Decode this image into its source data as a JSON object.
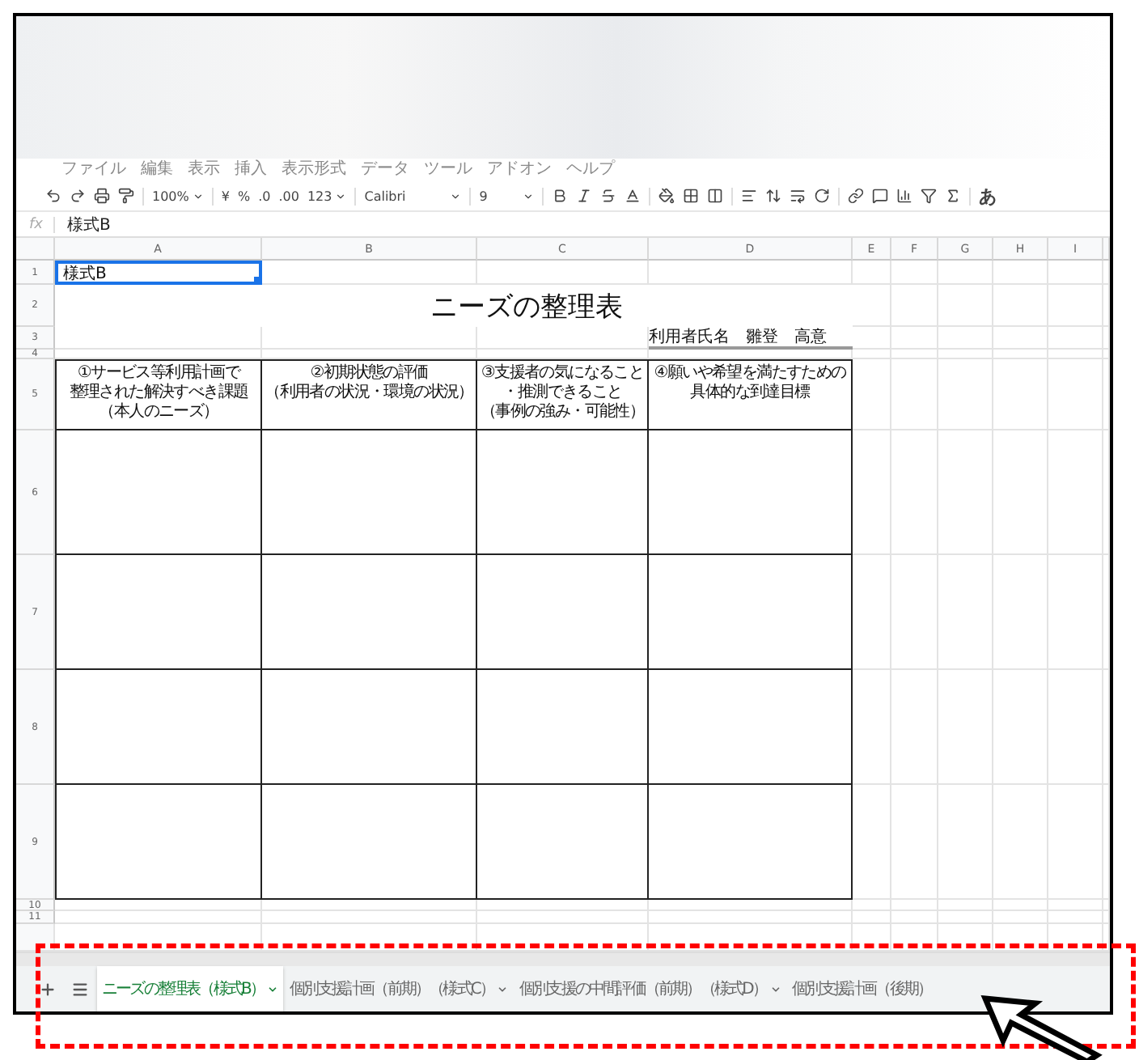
{
  "menu": [
    "ファイル",
    "編集",
    "表示",
    "挿入",
    "表示形式",
    "データ",
    "ツール",
    "アドオン",
    "ヘルプ"
  ],
  "toolbar": {
    "zoom": "100%",
    "currency": "¥",
    "percent": "%",
    "decimal_less": ".0",
    "decimal_more": ".00",
    "number_format": "123",
    "font": "Calibri",
    "font_size": "9",
    "input_mode": "あ"
  },
  "formula_bar": {
    "label": "fx",
    "value": "様式B"
  },
  "columns": [
    "A",
    "B",
    "C",
    "D",
    "E",
    "F",
    "G",
    "H",
    "I"
  ],
  "rows": [
    {
      "number": "1",
      "cells": [
        {
          "kind": "plain",
          "text": "様式B",
          "selected": true
        }
      ]
    },
    {
      "number": "2",
      "cells": [
        {
          "kind": "title",
          "text": "ニーズの整理表"
        }
      ]
    },
    {
      "number": "3",
      "cells": [
        {
          "kind": "owner",
          "text": "利用者氏名　雛登　高意"
        }
      ]
    },
    {
      "number": "4"
    },
    {
      "number": "5",
      "cells": [
        {
          "kind": "header",
          "lines": [
            "①サービス等利用計画で",
            "整理された解決すべき課題",
            "（本人のニーズ）"
          ]
        },
        {
          "kind": "header",
          "lines": [
            "②初期状態の評価",
            "（利用者の状況・環境の状況）"
          ]
        },
        {
          "kind": "header",
          "lines": [
            "③支援者の気になること",
            "・推測できること",
            "（事例の強み・可能性）"
          ]
        },
        {
          "kind": "header",
          "lines": [
            "④願いや希望を満たすための",
            "具体的な到達目標"
          ]
        }
      ]
    },
    {
      "number": "6",
      "cells": [
        {
          "kind": "box"
        },
        {
          "kind": "box"
        },
        {
          "kind": "box"
        },
        {
          "kind": "box"
        }
      ]
    },
    {
      "number": "7",
      "cells": [
        {
          "kind": "box"
        },
        {
          "kind": "box"
        },
        {
          "kind": "box"
        },
        {
          "kind": "box"
        }
      ]
    },
    {
      "number": "8",
      "cells": [
        {
          "kind": "box"
        },
        {
          "kind": "box"
        },
        {
          "kind": "box"
        },
        {
          "kind": "box"
        }
      ]
    },
    {
      "number": "9",
      "cells": [
        {
          "kind": "box"
        },
        {
          "kind": "box"
        },
        {
          "kind": "box"
        },
        {
          "kind": "box"
        }
      ]
    },
    {
      "number": "10"
    },
    {
      "number": "11"
    }
  ],
  "sheet_tabs": [
    {
      "label": "ニーズの整理表（様式B）",
      "selected": true,
      "dropdown": true
    },
    {
      "label": "個別支援計画（前期）（様式C）",
      "selected": false,
      "dropdown": true
    },
    {
      "label": "個別支援の中間評価（前期）（様式D）",
      "selected": false,
      "dropdown": true
    },
    {
      "label": "個別支援計画（後期）",
      "selected": false,
      "dropdown": false
    }
  ]
}
